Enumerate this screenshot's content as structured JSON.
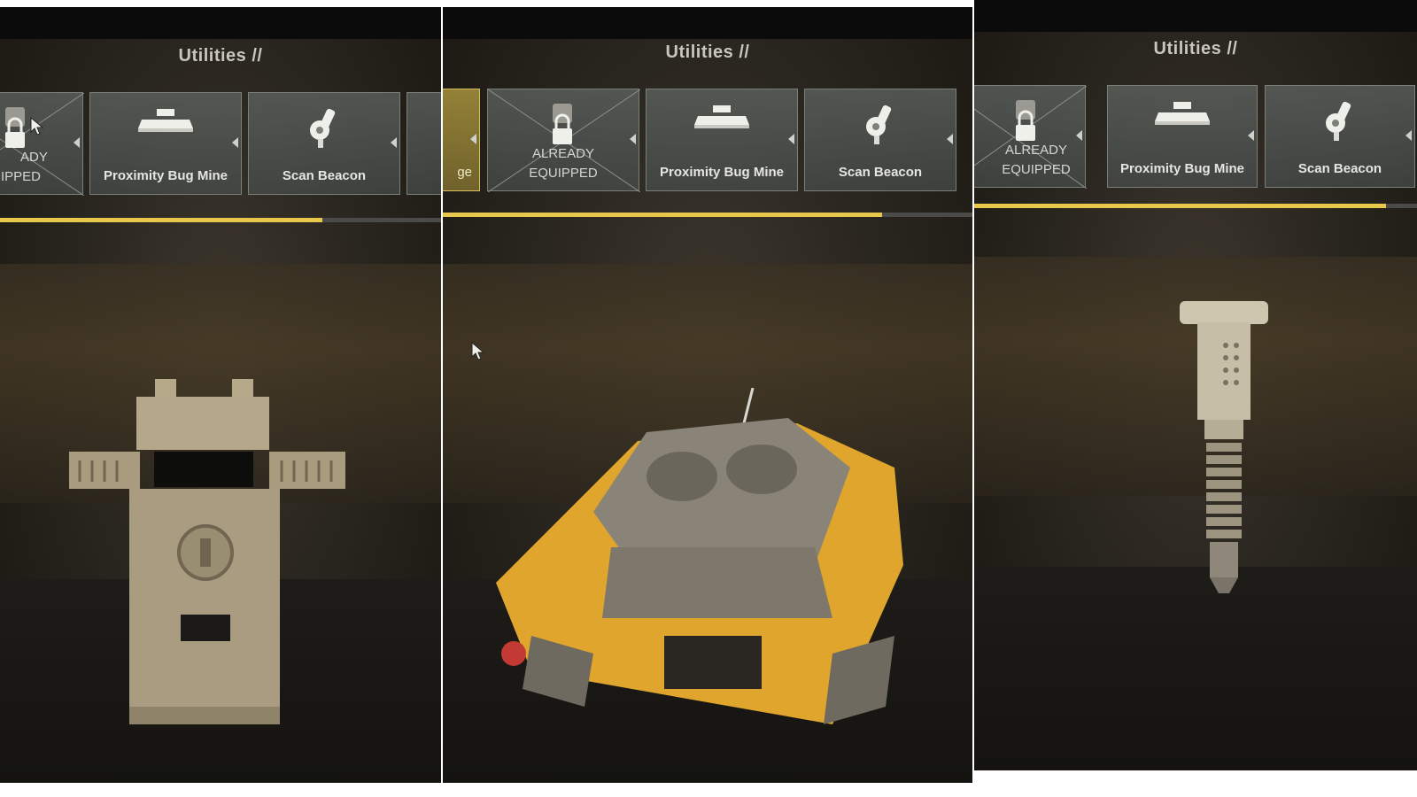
{
  "header": {
    "title": "Utilities //"
  },
  "cards": {
    "locked_label": "ALREADY EQUIPPED",
    "locked_label_partial_top": "ADY",
    "locked_label_partial_bottom": "IPPED",
    "locked_label_p3_top": "ALREADY",
    "locked_label_p3_bottom": "EQUIPPED",
    "locked_label_p2_top": "ALREADY",
    "locked_label_p2_bottom": "EQUIPPED",
    "mine_label": "Proximity Bug Mine",
    "beacon_label": "Scan Beacon",
    "partial_label": "ge"
  },
  "progress": [
    0.73,
    0.83,
    0.93
  ],
  "colors": {
    "accent": "#e8c84a",
    "card_border": "#7a7f78",
    "item_yellow": "#e0a52c"
  },
  "icons": [
    "lock-icon",
    "mine-icon",
    "beacon-icon",
    "cursor-icon"
  ]
}
